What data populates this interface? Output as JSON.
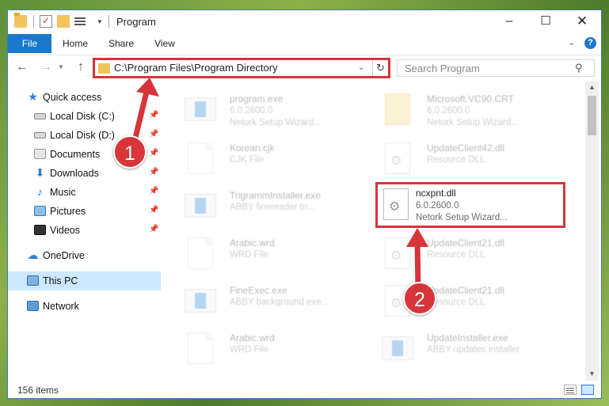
{
  "window": {
    "title": "Program"
  },
  "ribbon": {
    "file": "File",
    "home": "Home",
    "share": "Share",
    "view": "View",
    "help": "?"
  },
  "address": {
    "path": "C:\\Program Files\\Program Directory"
  },
  "search": {
    "placeholder": "Search Program"
  },
  "sidebar": {
    "items": [
      {
        "label": "Quick access",
        "icon": "star-icon"
      },
      {
        "label": "Local Disk (C:)",
        "icon": "drive-icon",
        "pinned": true
      },
      {
        "label": "Local Disk (D:)",
        "icon": "drive-icon",
        "pinned": true
      },
      {
        "label": "Documents",
        "icon": "documents-icon",
        "pinned": true
      },
      {
        "label": "Downloads",
        "icon": "download-icon",
        "pinned": true
      },
      {
        "label": "Music",
        "icon": "music-icon",
        "pinned": true
      },
      {
        "label": "Pictures",
        "icon": "pictures-icon",
        "pinned": true
      },
      {
        "label": "Videos",
        "icon": "video-icon",
        "pinned": true
      },
      {
        "label": "OneDrive",
        "icon": "cloud-icon"
      },
      {
        "label": "This PC",
        "icon": "computer-icon",
        "selected": true
      },
      {
        "label": "Network",
        "icon": "network-icon"
      }
    ]
  },
  "files": [
    {
      "name": "program.exe",
      "line2": "6.0.2600.0",
      "line3": "Netork Setup Wizard...",
      "icon": "exe-icon"
    },
    {
      "name": "Microsoft.VC90.CRT",
      "line2": "6.0.2600.0",
      "line3": "Netork Setup Wizard...",
      "icon": "folder-icon"
    },
    {
      "name": "Korean.cjk",
      "line2": "CJK File",
      "line3": "",
      "icon": "document-icon"
    },
    {
      "name": "UpdateClient42.dll",
      "line2": "Resource DLL",
      "line3": "",
      "icon": "dll-icon"
    },
    {
      "name": "TrigrammInstaller.exe",
      "line2": "ABBY finereader tri...",
      "line3": "",
      "icon": "exe-icon"
    },
    {
      "name": "ncxpnt.dll",
      "line2": "6.0.2600.0",
      "line3": "Netork Setup Wizard...",
      "icon": "dll-icon"
    },
    {
      "name": "Arabic.wrd",
      "line2": "WRD File",
      "line3": "",
      "icon": "document-icon"
    },
    {
      "name": "UpdateClient21.dll",
      "line2": "Resource DLL",
      "line3": "",
      "icon": "dll-icon"
    },
    {
      "name": "FineExec.exe",
      "line2": "ABBY background exe...",
      "line3": "",
      "icon": "exe-icon"
    },
    {
      "name": "UpdateClient21.dll",
      "line2": "Resource DLL",
      "line3": "",
      "icon": "dll-icon"
    },
    {
      "name": "Arabic.wrd",
      "line2": "WRD File",
      "line3": "",
      "icon": "document-icon"
    },
    {
      "name": "UpdateInstaller.exe",
      "line2": "ABBY updates installer",
      "line3": "",
      "icon": "exe-icon"
    }
  ],
  "status": {
    "item_count": "156 items"
  },
  "callouts": {
    "step1": "1",
    "step2": "2"
  },
  "colors": {
    "accent": "#1979ca",
    "callout": "#d6353a",
    "selected": "#cde8ff"
  }
}
